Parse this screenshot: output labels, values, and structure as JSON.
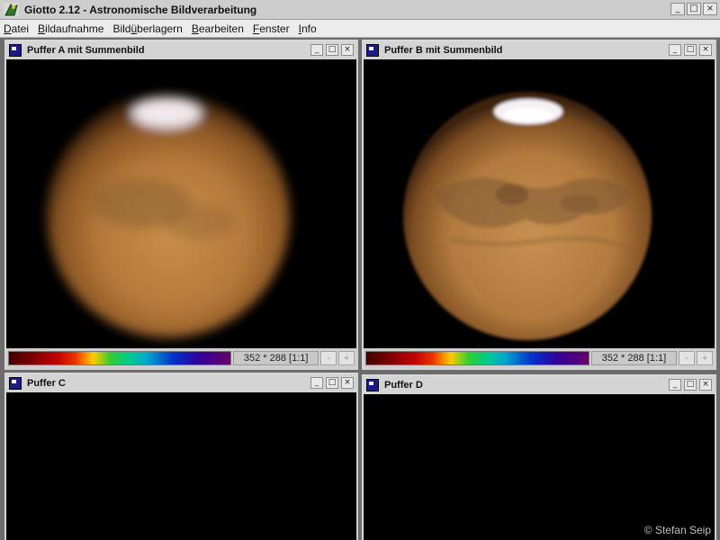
{
  "app": {
    "title": "Giotto 2.12 - Astronomische Bildverarbeitung",
    "controls": [
      "_",
      "□",
      "×"
    ]
  },
  "menu": [
    {
      "label": "Datei",
      "u": "D",
      "rest": "atei"
    },
    {
      "label": "Bildaufnahme",
      "u": "B",
      "rest": "ildaufnahme"
    },
    {
      "label": "Bildüberlagern",
      "pre": "Bild",
      "u": "ü",
      "rest": "berlagern"
    },
    {
      "label": "Bearbeiten",
      "u": "B",
      "rest": "earbeiten"
    },
    {
      "label": "Fenster",
      "u": "F",
      "rest": "enster"
    },
    {
      "label": "Info",
      "u": "I",
      "rest": "nfo"
    }
  ],
  "windows": {
    "a": {
      "title": "Puffer A mit Summenbild",
      "size": "352 * 288 [1:1]",
      "minus": "-",
      "plus": "+"
    },
    "b": {
      "title": "Puffer B mit Summenbild",
      "size": "352 * 288 [1:1]",
      "minus": "-",
      "plus": "+"
    },
    "c": {
      "title": "Puffer C"
    },
    "d": {
      "title": "Puffer D"
    },
    "controls": [
      "_",
      "□",
      "×"
    ]
  },
  "copyright": "© Stefan Seip",
  "colors": {
    "planet_core": "#c78a45",
    "planet_edge": "#5a3414",
    "polar_cap": "#f4eef0"
  }
}
